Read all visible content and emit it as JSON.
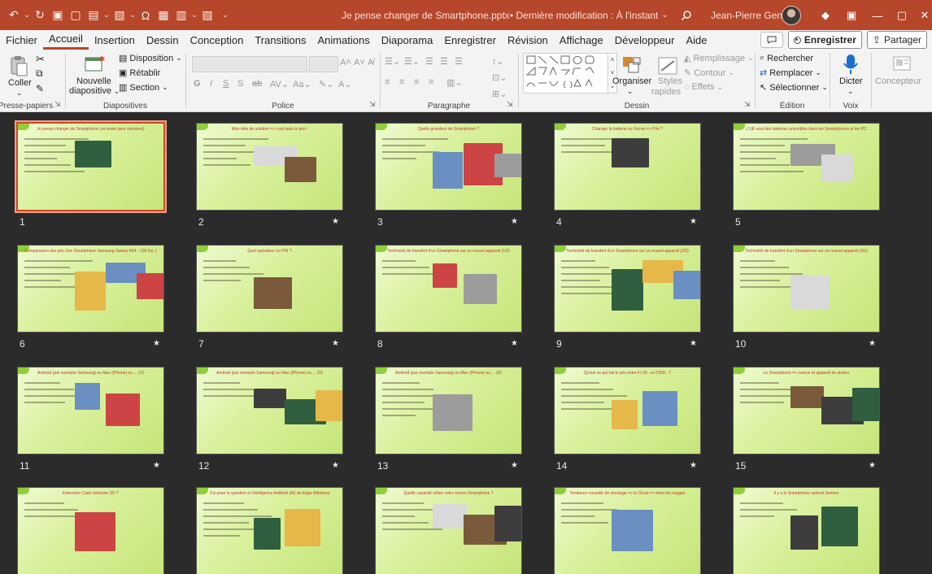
{
  "window": {
    "title": "Je pense changer de Smartphone.pptx",
    "title_suffix": " • Dernière modification : À l'instant",
    "user": "Jean-Pierre Gentil"
  },
  "colors": {
    "brand": "#b7472a",
    "slide_bg": "#d8f09a",
    "slide_title": "#c0392b",
    "selection": "#d24726"
  },
  "tabs": [
    "Fichier",
    "Accueil",
    "Insertion",
    "Dessin",
    "Conception",
    "Transitions",
    "Animations",
    "Diaporama",
    "Enregistrer",
    "Révision",
    "Affichage",
    "Développeur",
    "Aide"
  ],
  "active_tab": "Accueil",
  "actions": {
    "record": "Enregistrer",
    "share": "Partager"
  },
  "ribbon": {
    "clipboard": {
      "paste": "Coller",
      "label": "Presse-papiers"
    },
    "slides": {
      "new_line1": "Nouvelle",
      "new_line2": "diapositive",
      "layout": "Disposition",
      "reset": "Rétablir",
      "section": "Section",
      "label": "Diapositives"
    },
    "font": {
      "label": "Police"
    },
    "paragraph": {
      "label": "Paragraphe"
    },
    "drawing": {
      "arrange": "Organiser",
      "styles_line1": "Styles",
      "styles_line2": "rapides",
      "fill": "Remplissage",
      "outline": "Contour",
      "effects": "Effets",
      "label": "Dessin"
    },
    "editing": {
      "find": "Rechercher",
      "replace": "Remplacer",
      "select": "Sélectionner",
      "label": "Édition"
    },
    "voice": {
      "dictate": "Dicter",
      "label": "Voix"
    },
    "designer": {
      "label": "Concepteur"
    }
  },
  "slides": [
    {
      "num": "1",
      "title": "Je pense changer de Smartphone (ou tester pour voir/ainsi)",
      "star": false,
      "selected": true
    },
    {
      "num": "2",
      "title": "Mon idée de solution => cout mais le prix !",
      "star": true,
      "selected": false
    },
    {
      "num": "3",
      "title": "Quelle grandeur de Smartphone ?",
      "star": true,
      "selected": false
    },
    {
      "num": "4",
      "title": "Changer la batterie ou l'écran => Prix ?",
      "star": true,
      "selected": false
    },
    {
      "num": "5",
      "title": "L'UE veut des batteries amovibles dans les Smartphones et les PC",
      "star": false,
      "selected": false
    },
    {
      "num": "6",
      "title": "Comparaison des prix d'un Smartphone Samsung Galaxy A54 - 128 Go, (le prix %)",
      "star": true,
      "selected": false
    },
    {
      "num": "7",
      "title": "Quel opérateur ou PIN ?",
      "star": true,
      "selected": false
    },
    {
      "num": "8",
      "title": "Technicité de transfert d'un Smartphone sur un nouvel appareil (1/3)",
      "star": true,
      "selected": false
    },
    {
      "num": "9",
      "title": "Technicité de transfert d'un Smartphone sur un nouvel appareil (2/3)",
      "star": true,
      "selected": false
    },
    {
      "num": "10",
      "title": "Technicité de transfert d'un Smartphone sur un nouvel appareil (3/3)",
      "star": true,
      "selected": false
    },
    {
      "num": "11",
      "title": "Android (par exemple Samsung) ou Mac (iPhone) ou ...  1/3",
      "star": true,
      "selected": false
    },
    {
      "num": "12",
      "title": "Android (par exemple Samsung) ou Mac (iPhone) ou ...  2/3",
      "star": true,
      "selected": false
    },
    {
      "num": "13",
      "title": "Android (par exemple Samsung) ou Mac (iPhone) ou ...  3/3",
      "star": true,
      "selected": false
    },
    {
      "num": "14",
      "title": "Qu'est ce qui fait le prix entre Fr 50.- et 2'000.- ?",
      "star": true,
      "selected": false
    },
    {
      "num": "15",
      "title": "Le Smartphone => source et appareil de photos",
      "star": true,
      "selected": false
    },
    {
      "num": "16",
      "title": "Extension Carte mémoire SD ?",
      "star": false,
      "selected": false
    },
    {
      "num": "17",
      "title": "J'ai posé la question à l'intelligence Artificiel (AI) de Edge Windows",
      "star": false,
      "selected": false
    },
    {
      "num": "18",
      "title": "Quelle capacité utilise votre ancien Smartphone ?",
      "star": false,
      "selected": false
    },
    {
      "num": "19",
      "title": "Tendance nouvelle de stockage => le Cloud => dans les nuages",
      "star": false,
      "selected": false
    },
    {
      "num": "20",
      "title": "Il y a le Smartphone spécial Seniors",
      "star": false,
      "selected": false
    }
  ]
}
